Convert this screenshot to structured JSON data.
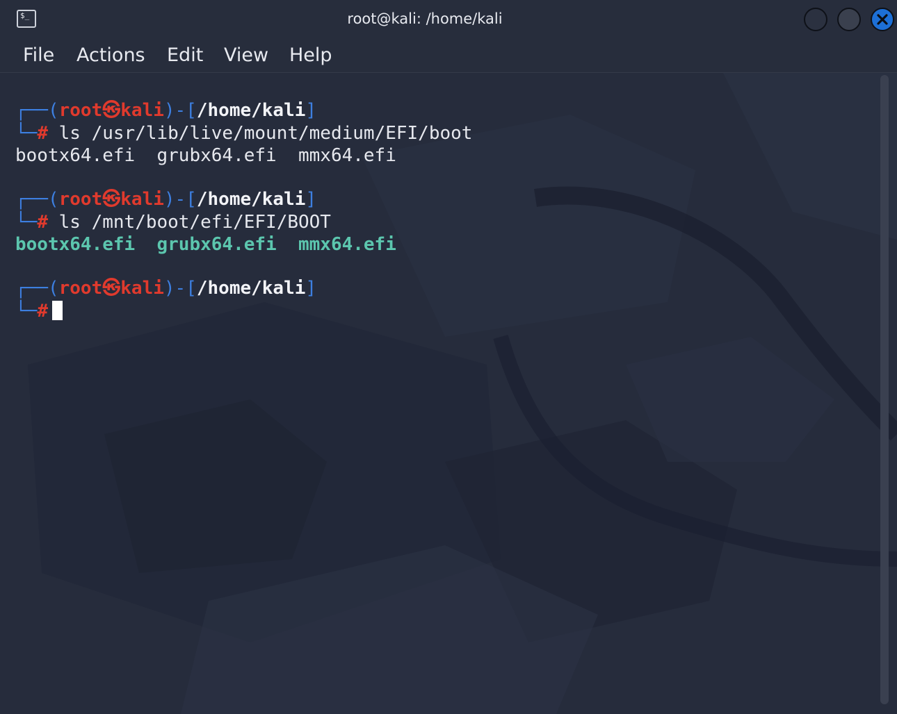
{
  "window": {
    "title": "root@kali: /home/kali"
  },
  "titlebar_icons": {
    "app_icon": "terminal-icon",
    "app_icon_glyph": "$_",
    "minimize": "minimize-circle",
    "maximize": "maximize-circle",
    "close": "close-x-icon",
    "close_color": "#1d6fd6"
  },
  "menu": {
    "items": [
      {
        "label": "File"
      },
      {
        "label": "Actions"
      },
      {
        "label": "Edit"
      },
      {
        "label": "View"
      },
      {
        "label": "Help"
      }
    ]
  },
  "colors": {
    "prompt_frame": "#3d7fe0",
    "prompt_user": "#e03a2d",
    "directory_listing": "#5cc6ae",
    "background": "#262c3c"
  },
  "terminal": {
    "prompt": {
      "corner_top": "┌──(",
      "user": "root",
      "skull": "㉿",
      "host": "kali",
      "sep_open": ")-[",
      "cwd": "/home/kali",
      "sep_close": "]",
      "corner_bottom": "└─",
      "hash": "#"
    },
    "blocks": [
      {
        "command": "ls /usr/lib/live/mount/medium/EFI/boot",
        "output": "bootx64.efi  grubx64.efi  mmx64.efi"
      },
      {
        "command": "ls /mnt/boot/efi/EFI/BOOT",
        "output": "bootx64.efi  grubx64.efi  mmx64.efi"
      },
      {
        "command": "",
        "output": ""
      }
    ]
  }
}
